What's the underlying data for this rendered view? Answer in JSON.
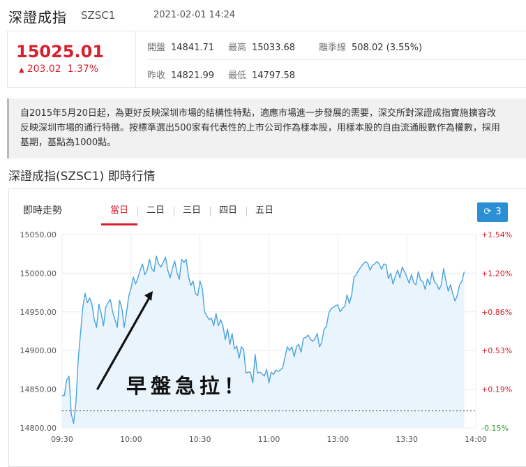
{
  "header": {
    "title": "深證成指",
    "code": "SZSC1",
    "datetime": "2021-02-01 14:24"
  },
  "quote": {
    "price": "15025.01",
    "change": "203.02",
    "change_pct": "1.37%",
    "stats": [
      {
        "label": "開盤",
        "value": "14841.71"
      },
      {
        "label": "最高",
        "value": "15033.68"
      },
      {
        "label": "離季線",
        "value": "508.02 (3.55%)"
      },
      {
        "label": "昨收",
        "value": "14821.99"
      },
      {
        "label": "最低",
        "value": "14797.58"
      }
    ]
  },
  "description": {
    "lines": [
      "自2015年5月20日起，為更好反映深圳市場的結構性特點，適應市場進一步發展的需要，深交所對深證成指實施擴容改",
      "反映深圳市場的通行特徵。按標準選出500家有代表性的上市公司作為樣本股，用樣本股的自由流通股數作為權數，採用",
      "基期，基點為1000點。"
    ]
  },
  "section_title": "深證成指(SZSC1) 即時行情",
  "panel": {
    "title": "即時走勢",
    "tabs": [
      "當日",
      "二日",
      "三日",
      "四日",
      "五日"
    ],
    "active_tab": 0,
    "refresh_label": "3"
  },
  "annotation": {
    "text": "早盤急拉！"
  },
  "colors": {
    "red": "#d6212f",
    "green": "#2e9e35",
    "line": "#4aa3df",
    "fill": "#eaf4fc",
    "button": "#2b8fd6"
  },
  "chart_data": {
    "type": "area",
    "x_ticks": [
      "09:30",
      "10:00",
      "10:30",
      "11:00",
      "13:00",
      "13:30",
      "14:00"
    ],
    "y_ticks": [
      "15050.00",
      "15000.00",
      "14950.00",
      "14900.00",
      "14850.00",
      "14800.00"
    ],
    "y_right_ticks": [
      "+1.54%",
      "+1.20%",
      "+0.86%",
      "+0.53%",
      "+0.19%",
      "-0.15%"
    ],
    "ylim": [
      14800,
      15050
    ],
    "prev_close": 14821.99,
    "x_range": [
      0,
      175
    ],
    "x_tick_positions": [
      0,
      30,
      60,
      90,
      120,
      150,
      180
    ],
    "x": [
      0,
      1,
      2,
      3,
      4,
      5,
      6,
      7,
      8,
      9,
      10,
      11,
      12,
      13,
      14,
      15,
      16,
      17,
      18,
      19,
      20,
      21,
      22,
      23,
      24,
      25,
      26,
      27,
      28,
      29,
      30,
      31,
      32,
      33,
      34,
      35,
      36,
      37,
      38,
      39,
      40,
      41,
      42,
      43,
      44,
      45,
      46,
      47,
      48,
      49,
      50,
      51,
      52,
      53,
      54,
      55,
      56,
      57,
      58,
      59,
      60,
      61,
      62,
      63,
      64,
      65,
      66,
      67,
      68,
      69,
      70,
      71,
      72,
      73,
      74,
      75,
      76,
      77,
      78,
      79,
      80,
      81,
      82,
      83,
      84,
      85,
      86,
      87,
      88,
      89,
      90,
      91,
      92,
      93,
      94,
      95,
      96,
      97,
      98,
      99,
      100,
      101,
      102,
      103,
      104,
      105,
      106,
      107,
      108,
      109,
      110,
      111,
      112,
      113,
      114,
      115,
      116,
      117,
      118,
      119,
      120,
      121,
      122,
      123,
      124,
      125,
      126,
      127,
      128,
      129,
      130,
      131,
      132,
      133,
      134,
      135,
      136,
      137,
      138,
      139,
      140,
      141,
      142,
      143,
      144,
      145,
      146,
      147,
      148,
      149,
      150,
      151,
      152,
      153,
      154,
      155,
      156,
      157,
      158,
      159,
      160,
      161,
      162,
      163,
      164,
      165,
      166,
      167,
      168,
      169,
      170,
      171,
      172,
      173,
      174,
      175
    ],
    "values": [
      14842,
      14842,
      14862,
      14867,
      14818,
      14806,
      14832,
      14888,
      14922,
      14956,
      14974,
      14962,
      14968,
      14960,
      14940,
      14930,
      14960,
      14948,
      14932,
      14956,
      14962,
      14966,
      14950,
      14940,
      14930,
      14965,
      14955,
      14930,
      14948,
      14970,
      14980,
      14995,
      14986,
      14994,
      15004,
      15012,
      14998,
      15004,
      15018,
      15006,
      15002,
      15022,
      15012,
      15008,
      15014,
      15021,
      15004,
      14994,
      15006,
      15016,
      15001,
      14992,
      15018,
      15014,
      15018,
      14996,
      14984,
      14990,
      14974,
      14971,
      14990,
      14980,
      14950,
      14945,
      14940,
      14942,
      14932,
      14948,
      14932,
      14940,
      14932,
      14914,
      14928,
      14908,
      14922,
      14902,
      14906,
      14890,
      14905,
      14901,
      14871,
      14872,
      14872,
      14858,
      14895,
      14871,
      14872,
      14870,
      14867,
      14876,
      14858,
      14872,
      14869,
      14875,
      14873,
      14875,
      14878,
      14892,
      14905,
      14900,
      14905,
      14892,
      14905,
      14908,
      14898,
      14916,
      14917,
      14920,
      14915,
      14912,
      14915,
      14922,
      14905,
      14911,
      14928,
      14931,
      14948,
      14954,
      14956,
      14958,
      14959,
      14950,
      14955,
      14957,
      14972,
      14961,
      14972,
      14995,
      14998,
      15004,
      15008,
      15012,
      15015,
      15013,
      15004,
      15010,
      15012,
      15015,
      15012,
      15005,
      15012,
      15011,
      14993,
      15000,
      14986,
      14996,
      15004,
      14994,
      15008,
      15002,
      14995,
      14987,
      14998,
      14988,
      14985,
      15002,
      14991,
      14989,
      14979,
      14993,
      14985,
      15002,
      14989,
      14986,
      14979,
      14985,
      15006,
      14990,
      14977,
      14985,
      14973,
      14964,
      14972,
      14985,
      14990,
      15002
    ],
    "grid": true
  }
}
